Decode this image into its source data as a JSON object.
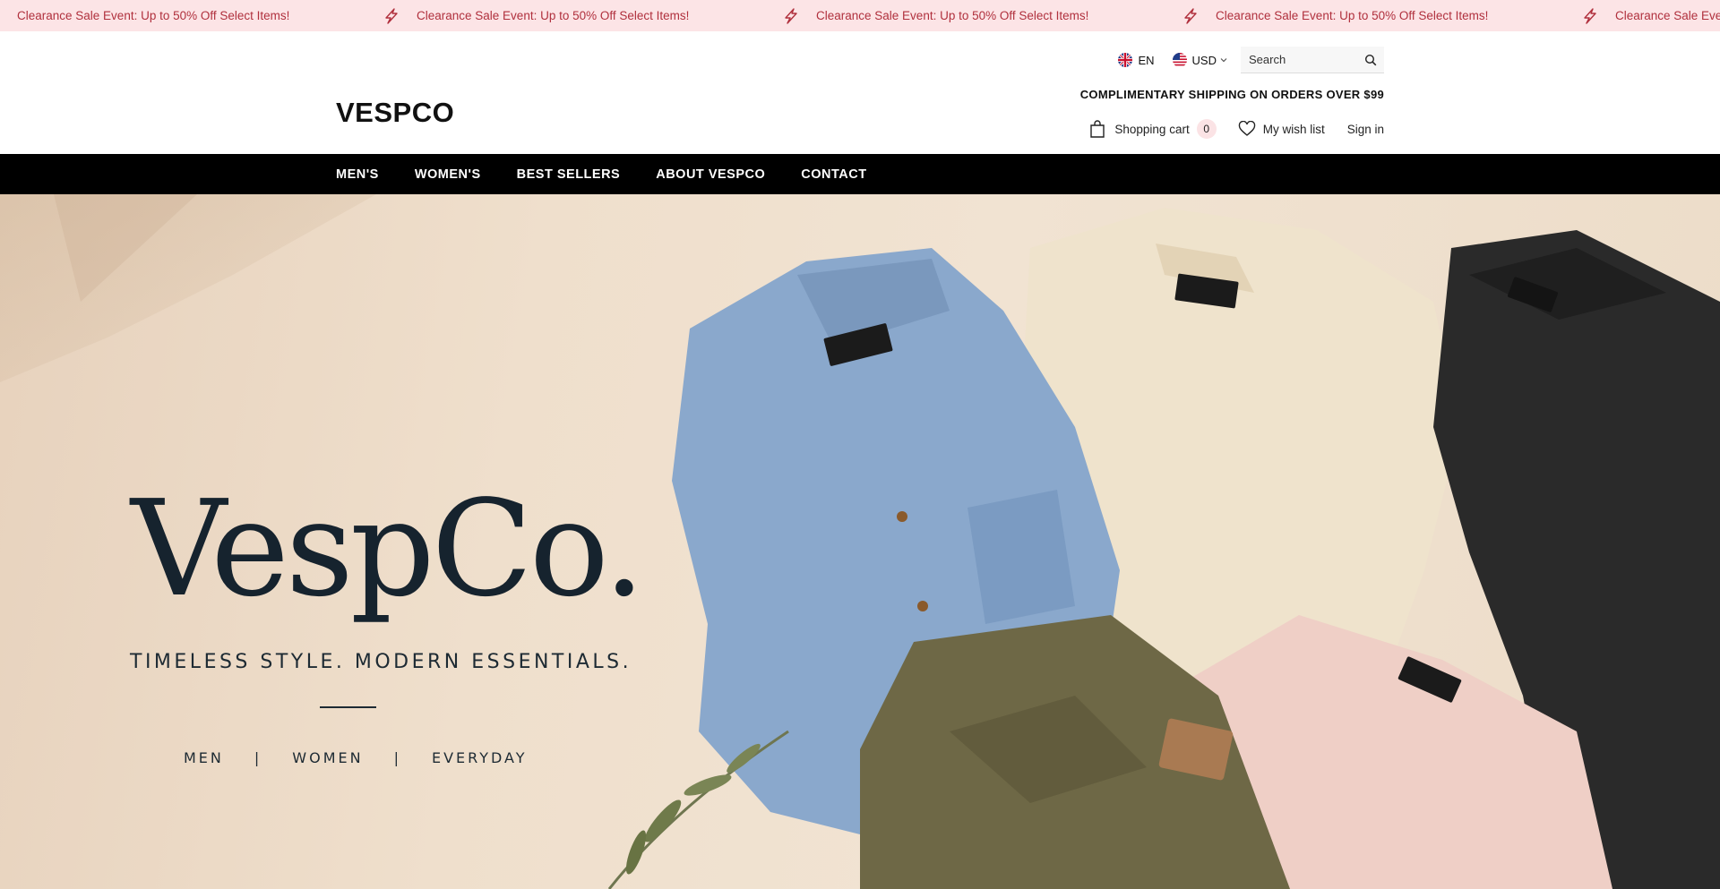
{
  "promo": {
    "message": "Clearance Sale Event: Up to 50% Off Select Items!",
    "icon": "lightning-bolt-icon",
    "color": "#b0303d",
    "background": "#fce4e6"
  },
  "header": {
    "logo": "VESPCO",
    "language": {
      "label": "EN",
      "icon": "uk-flag-icon"
    },
    "currency": {
      "label": "USD",
      "icon": "us-flag-icon"
    },
    "search": {
      "placeholder": "Search",
      "value": ""
    },
    "shipping_note": "COMPLIMENTARY SHIPPING ON ORDERS OVER $99",
    "cart": {
      "label": "Shopping cart",
      "count": "0"
    },
    "wishlist": {
      "label": "My wish list"
    },
    "signin": {
      "label": "Sign in"
    }
  },
  "nav": {
    "items": [
      {
        "label": "MEN'S"
      },
      {
        "label": "WOMEN'S"
      },
      {
        "label": "BEST SELLERS"
      },
      {
        "label": "ABOUT VESPCO"
      },
      {
        "label": "CONTACT"
      }
    ]
  },
  "hero": {
    "brand": "VespCo.",
    "tagline": "TIMELESS STYLE. MODERN ESSENTIALS.",
    "categories": [
      "MEN",
      "WOMEN",
      "EVERYDAY"
    ],
    "separator": "|",
    "label_text": "VespCo."
  }
}
